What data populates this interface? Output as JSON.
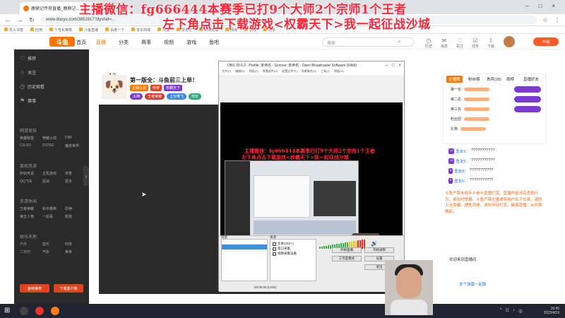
{
  "overlay": {
    "line1": "主播微信：fg666444本赛季已打9个大师2个宗师1个王者",
    "line2": "左下角点击下载游戏<权霸天下>我一起征战沙城"
  },
  "browser": {
    "tab_title": "鹿鼎记传奇直播_鹿鼎记...",
    "url": "www.douyu.com/3852817?dyshid=...",
    "bookmarks": [
      "导入书签",
      "应用",
      "个性化推荐",
      "斗鱼直播",
      "百度一下",
      "京东商城",
      "天猫",
      "爱奇艺",
      "新浪微博",
      "网易",
      "游戏",
      "更多"
    ]
  },
  "site": {
    "logo": "斗鱼",
    "nav": [
      "首页",
      "直播",
      "分类",
      "赛事",
      "视频",
      "游戏",
      "鱼吧"
    ],
    "search_placeholder": "搜索",
    "header_icons": [
      "历史",
      "消息",
      "关注",
      "任务",
      "下载"
    ],
    "open_live": "开播"
  },
  "sidebar": {
    "items": [
      "推荐",
      "关注",
      "历史观看",
      "赛事"
    ],
    "sections": [
      "网游竞技",
      "单机热游",
      "手游休闲",
      "娱乐天地"
    ],
    "grid": [
      "英雄联盟",
      "穿越火线",
      "DNF",
      "CS:GO",
      "DOTA2",
      "魔兽世界",
      "炉石传说",
      "主机游戏",
      "传奇",
      "QQ飞车",
      "逆战",
      "更多",
      "王者荣耀",
      "和平精英",
      "原神",
      "第五人格",
      "一起看",
      "颜值",
      "户外",
      "音乐",
      "科技",
      "二次元",
      "汽车",
      "美食"
    ],
    "bottom_btn1": "鱼吧推荐",
    "bottom_btn2": "下载客户端"
  },
  "room": {
    "rank": "12",
    "title": "第一版全：斗鱼前三上单！",
    "tags": [
      "主播认证",
      "传奇",
      "权霸天下"
    ],
    "badges": [
      "大神",
      "王者荣耀",
      "上分带飞",
      "陪玩"
    ]
  },
  "obs": {
    "title": "OBS 30.0.2 - Profile: 未命名 - Scenes: 未命名 - Open Broadcaster Software (64bit)",
    "menu": [
      "文件(F)",
      "编辑(E)",
      "视图(V)",
      "停靠部件(D)",
      "配置文件(P)",
      "场景集合(S)",
      "工具(T)",
      "帮助(H)"
    ],
    "inner_line1": "主播微信：fg666444本赛季已打9个大师2个宗师1个王者",
    "inner_line2": "左下角点击下载游戏<权霸天下>我一起征战沙城",
    "scenes_label": "场景",
    "sources_label": "来源",
    "sources": [
      "文本(GDI+)",
      "窗口采集",
      "视频采集设备"
    ],
    "buttons": [
      "开始直播",
      "开始录制",
      "工作室模式",
      "设置",
      "退出"
    ],
    "status": "00:00:00 (LIVE)"
  },
  "rank_panel": {
    "tabs": [
      "主播榜",
      "粉丝榜",
      "贵宾(28)",
      "周榜",
      "直播好友"
    ],
    "rows": [
      "第一名",
      "第二名",
      "第三名",
      "粉丝团",
      "礼物"
    ]
  },
  "chat": {
    "messages": [
      {
        "user": "鱼友3",
        "level": "12",
        "text": "???????????"
      },
      {
        "user": "鱼友5",
        "level": "10",
        "text": "???????????"
      },
      {
        "user": "鱼友8",
        "level": "8",
        "text": "???????????"
      },
      {
        "user": "鱼友6",
        "level": "9",
        "text": "???????????"
      }
    ],
    "notice": "斗鱼严禁未成年人参与直播打赏。直播内容涉及违规行为，请及时举报。斗鱼严禁主播诱导用户私下交易，谨防上当受骗。理性消费，请勿冲动打赏，健康直播，从你我做起。",
    "bottom_msg": "欢迎来到直播间",
    "bottom_msg2": "发个弹幕一起聊"
  },
  "taskbar": {
    "time": "16:45",
    "date": "2023/4/19"
  }
}
